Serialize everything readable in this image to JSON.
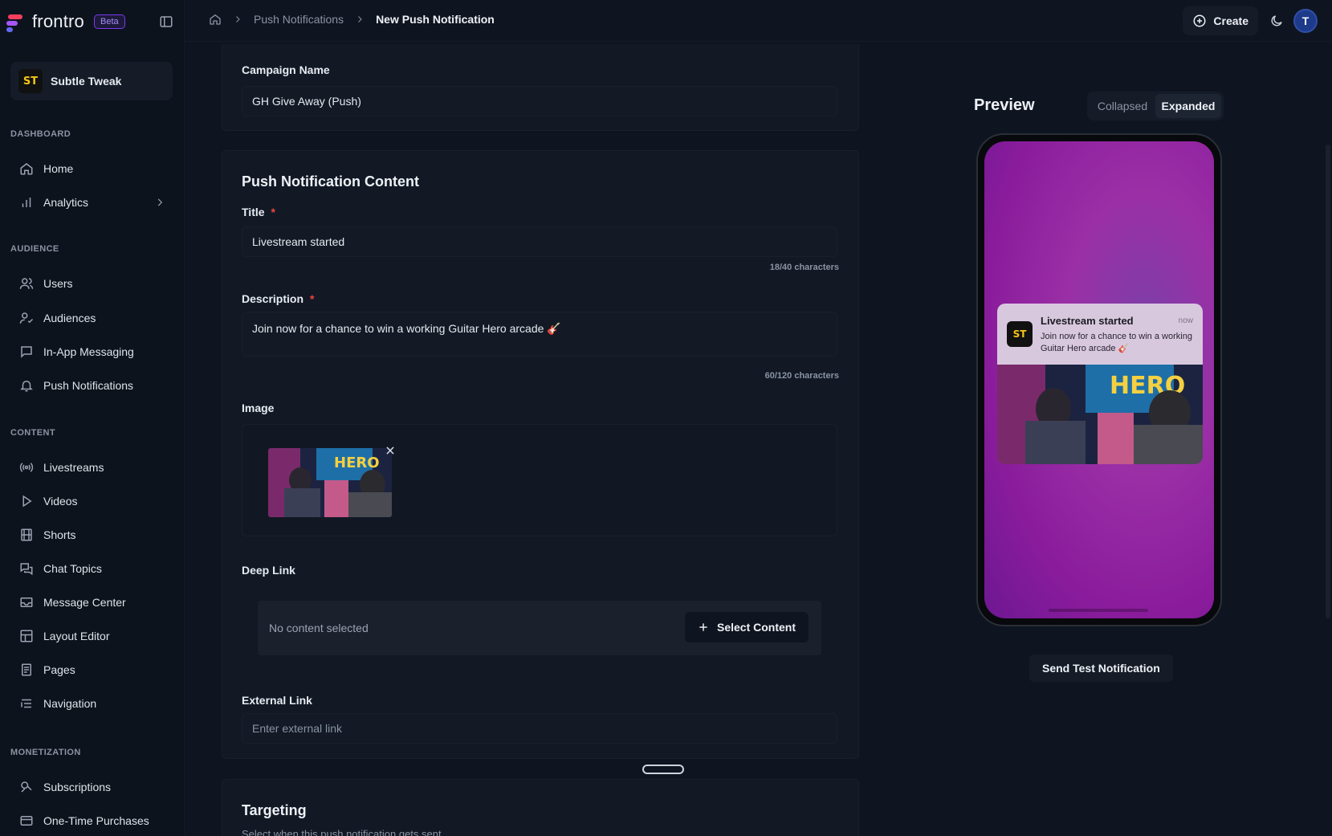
{
  "brand": {
    "name": "frontro",
    "badge": "Beta",
    "accent": "#a78bfa"
  },
  "workspace": {
    "logo_text": "ST",
    "name": "Subtle Tweak"
  },
  "sidebar": {
    "sections": {
      "dashboard": "DASHBOARD",
      "audience": "AUDIENCE",
      "content": "CONTENT",
      "monetization": "MONETIZATION"
    },
    "items": [
      {
        "label": "Home",
        "icon": "home-icon"
      },
      {
        "label": "Analytics",
        "icon": "bar-chart-icon"
      },
      {
        "label": "Users",
        "icon": "users-icon"
      },
      {
        "label": "Audiences",
        "icon": "audiences-icon"
      },
      {
        "label": "In-App Messaging",
        "icon": "message-square-icon"
      },
      {
        "label": "Push Notifications",
        "icon": "bell-icon"
      },
      {
        "label": "Livestreams",
        "icon": "broadcast-icon"
      },
      {
        "label": "Videos",
        "icon": "play-icon"
      },
      {
        "label": "Shorts",
        "icon": "film-icon"
      },
      {
        "label": "Chat Topics",
        "icon": "chat-icon"
      },
      {
        "label": "Message Center",
        "icon": "inbox-icon"
      },
      {
        "label": "Layout Editor",
        "icon": "layout-icon"
      },
      {
        "label": "Pages",
        "icon": "pages-icon"
      },
      {
        "label": "Navigation",
        "icon": "list-icon"
      },
      {
        "label": "Subscriptions",
        "icon": "subscriptions-icon"
      },
      {
        "label": "One-Time Purchases",
        "icon": "card-icon"
      }
    ]
  },
  "topbar": {
    "breadcrumbs": [
      "Push Notifications",
      "New Push Notification"
    ],
    "create_label": "Create",
    "avatar_initial": "T"
  },
  "form": {
    "campaign_name_label": "Campaign Name",
    "campaign_name_value": "GH Give Away (Push)",
    "content_title": "Push Notification Content",
    "title_label": "Title",
    "title_value": "Livestream started",
    "title_counter": "18/40 characters",
    "description_label": "Description",
    "description_value": "Join now for a chance to win a working Guitar Hero arcade 🎸",
    "description_counter": "60/120 characters",
    "required_marker": "*",
    "image_label": "Image",
    "deep_link_label": "Deep Link",
    "deep_link_empty": "No content selected",
    "select_content_label": "Select Content",
    "external_link_label": "External Link",
    "external_link_placeholder": "Enter external link",
    "targeting_title": "Targeting",
    "targeting_subtitle": "Select when this push notification gets sent"
  },
  "preview": {
    "title": "Preview",
    "toggle": [
      "Collapsed",
      "Expanded"
    ],
    "active_toggle": "Expanded",
    "notification": {
      "app_icon_text": "ST",
      "title": "Livestream started",
      "time": "now",
      "body": "Join now for a chance to win a working Guitar Hero arcade 🎸"
    },
    "send_test_label": "Send Test Notification"
  }
}
